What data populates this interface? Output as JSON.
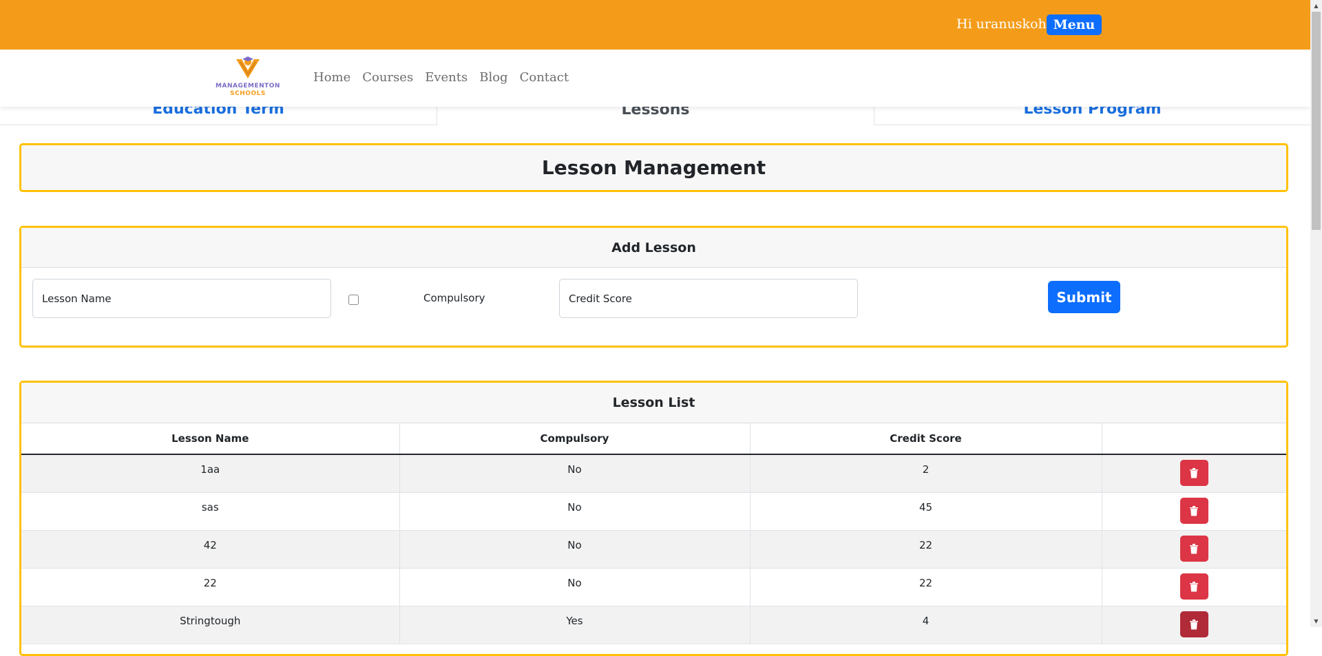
{
  "topbar": {
    "greeting": "Hi uranuskohi",
    "menu_label": "Menu"
  },
  "logo": {
    "line1": "MANAGEMENTON",
    "line2": "SCHOOLS"
  },
  "nav": [
    "Home",
    "Courses",
    "Events",
    "Blog",
    "Contact"
  ],
  "tabs": [
    "Education Term",
    "Lessons",
    "Lesson Program"
  ],
  "management": {
    "title": "Lesson Management"
  },
  "add_lesson": {
    "title": "Add Lesson",
    "name_placeholder": "Lesson Name",
    "compulsory_label": "Compulsory",
    "credit_placeholder": "Credit Score",
    "submit_label": "Submit"
  },
  "lesson_list": {
    "title": "Lesson List",
    "columns": [
      "Lesson Name",
      "Compulsory",
      "Credit Score",
      ""
    ],
    "rows": [
      {
        "name": "1aa",
        "compulsory": "No",
        "credit": "2"
      },
      {
        "name": "sas",
        "compulsory": "No",
        "credit": "45"
      },
      {
        "name": "42",
        "compulsory": "No",
        "credit": "22"
      },
      {
        "name": "22",
        "compulsory": "No",
        "credit": "22"
      },
      {
        "name": "Stringtough",
        "compulsory": "Yes",
        "credit": "4"
      }
    ]
  },
  "colors": {
    "accent_orange": "#f49c1a",
    "primary_blue": "#0d6efd",
    "danger_red": "#dc3545",
    "card_border": "#ffc107"
  }
}
